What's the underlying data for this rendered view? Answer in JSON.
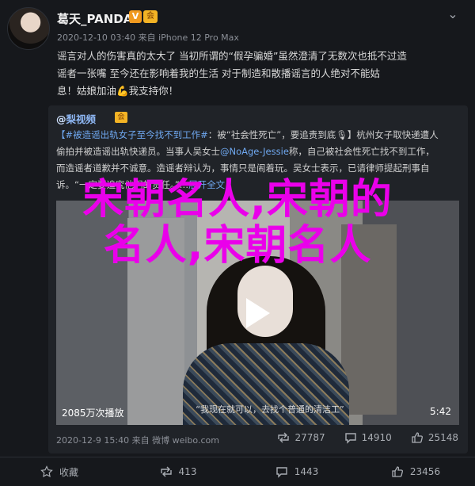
{
  "post": {
    "username": "葛天_PANDA",
    "vip_badge": "V",
    "member_badge": "会",
    "collapse_glyph": "⌄",
    "meta": "2020-12-10 03:40 来自 iPhone 12 Pro Max",
    "text_lines": [
      "谣言对人的伤害真的太大了 当初所谓的“假孕骗婚”虽然澄清了无数次也抵不过造",
      "谣者一张嘴 至今还在影响着我的生活 对于制造和散播谣言的人绝对不能姑",
      "息！姑娘加油💪我支持你！"
    ]
  },
  "repost": {
    "author_prefix": "@",
    "author_name": "梨视频",
    "author_badge": "会",
    "text_lines": [
      {
        "pre": "【#被造谣出轨女子至今找不到工作#",
        "post": "：被“社会性死亡”，要追责到底🎙】杭州女子取快递遭人"
      },
      {
        "pre": "偷拍并被造谣出轨快递员。当事人吴女士",
        "link": "@NoAge-Jessie",
        "post": "称，自己被社会性死亡找不到工作，"
      },
      {
        "pre": "而造谣者道歉并不诚意。造谣者辩认为，事情只是闹着玩。吴女士表示，已请律师提起刑事自"
      },
      {
        "pre": "诉。“一定要追究他们的责任。”…",
        "link": "展开全文",
        "post": "⌄"
      }
    ],
    "video": {
      "caption": "“我现在就可以，去找个普通的清洁工”",
      "views": "2085万次播放",
      "duration": "5:42"
    },
    "footer": "2020-12-9 15:40 来自 微博 weibo.com",
    "stats": {
      "reposts": "27787",
      "comments": "14910",
      "likes": "25148"
    }
  },
  "overlay_title": [
    "宋朝名人,宋朝的",
    "名人,宋朝名人"
  ],
  "actions": {
    "favorite": "收藏",
    "repost": "413",
    "comment": "1443",
    "like": "23456"
  },
  "colors": {
    "background": "#16181c",
    "overlay": "#ea00ea",
    "link": "#6fa8f0",
    "badge_orange": "#f19a1f"
  }
}
